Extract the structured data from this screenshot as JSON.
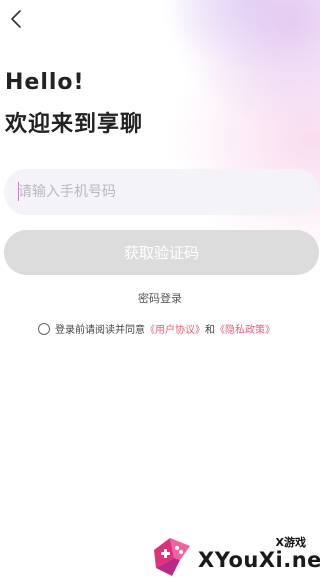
{
  "header": {
    "greeting": "Hello!",
    "welcome": "欢迎来到享聊"
  },
  "form": {
    "phone_placeholder": "请输入手机号码",
    "phone_value": "",
    "get_code_label": "获取验证码",
    "password_login_label": "密码登录"
  },
  "agreement": {
    "prefix": "登录前请阅读并同意",
    "user_agreement": "《用户协议》",
    "conjunction": "和",
    "privacy_policy": "《隐私政策》",
    "checked": false
  },
  "watermark": {
    "top_text": "X游戏",
    "main_text": "XYouXi.net"
  },
  "colors": {
    "link": "#e8607a",
    "button_disabled": "#dcdcdc",
    "input_bg": "#f4f3f7",
    "cursor": "#d07be0"
  },
  "icons": {
    "back": "chevron-left-icon",
    "radio": "radio-unchecked-icon",
    "watermark_logo": "gamepad-logo"
  }
}
